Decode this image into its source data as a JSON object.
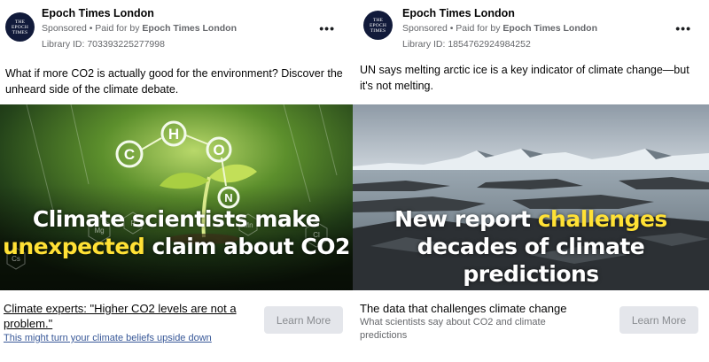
{
  "ads": [
    {
      "logo_lines": [
        "THE",
        "EPOCH",
        "TIMES"
      ],
      "page_name": "Epoch Times London",
      "sponsored": "Sponsored",
      "paid_for_prefix": " • Paid for by ",
      "paid_for_by": "Epoch Times London",
      "library_id": "Library ID: 703393225277998",
      "more_label": "•••",
      "body": "What if more CO2 is actually good for the environment? Discover the unheard side of the climate debate.",
      "image_text": {
        "line1": "Climate scientists make",
        "line2_highlight": "unexpected",
        "line2_rest": " claim about CO2",
        "elements": [
          "C",
          "H",
          "O",
          "N",
          "P",
          "Cl",
          "Mg",
          "Mn",
          "Cs"
        ]
      },
      "link_title": "Climate experts: \"Higher CO2 levels are not a problem.\"",
      "link_description": "This might turn your climate beliefs upside down",
      "cta": "Learn More"
    },
    {
      "logo_lines": [
        "THE",
        "EPOCH",
        "TIMES"
      ],
      "page_name": "Epoch Times London",
      "sponsored": "Sponsored",
      "paid_for_prefix": " • Paid for by ",
      "paid_for_by": "Epoch Times London",
      "library_id": "Library ID: 1854762924984252",
      "more_label": "•••",
      "body": "UN says melting arctic ice is a key indicator of climate change—but it's not melting.",
      "image_text": {
        "line1_pre": "New report ",
        "line1_highlight": "challenges",
        "line2": "decades of climate predictions"
      },
      "link_title": "The data that challenges climate change",
      "link_description": "What scientists say about CO2 and climate predictions",
      "cta": "Learn More"
    }
  ],
  "colors": {
    "highlight": "#ffe135",
    "meta_gray": "#65676b",
    "button_bg": "#e4e6eb",
    "logo_bg": "#111a3a"
  }
}
